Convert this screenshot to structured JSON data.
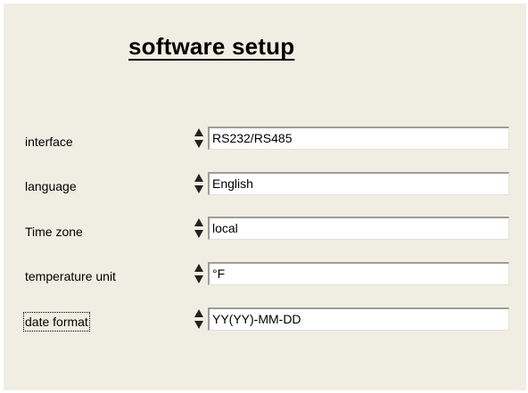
{
  "title": "software setup",
  "rows": [
    {
      "label": "interface",
      "value": "RS232/RS485"
    },
    {
      "label": "language",
      "value": "English"
    },
    {
      "label": "Time zone",
      "value": "local"
    },
    {
      "label": "temperature unit",
      "value": "°F"
    },
    {
      "label": "date format",
      "value": "YY(YY)-MM-DD"
    }
  ],
  "icons": {
    "spinner": "up-down-arrows-icon"
  },
  "colors": {
    "panel_background": "#f0eee2",
    "field_background": "#ffffff"
  }
}
